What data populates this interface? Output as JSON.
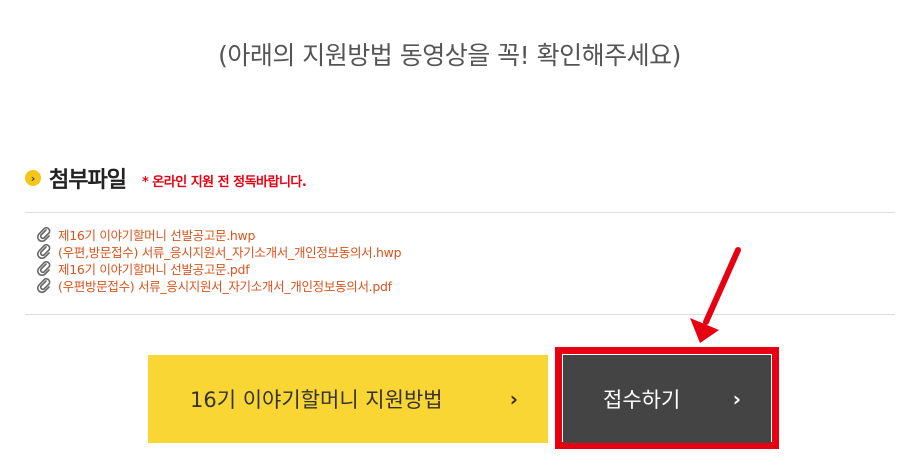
{
  "notice": "(아래의 지원방법 동영상을 꼭! 확인해주세요)",
  "attachments": {
    "title": "첨부파일",
    "warning": "* 온라인 지원 전 정독바랍니다.",
    "files": [
      "제16기 이야기할머니 선발공고문.hwp",
      "(우편,방문접수) 서류_응시지원서_자기소개서_개인정보동의서.hwp",
      "제16기 이야기할머니 선발공고문.pdf",
      "(우편방문접수) 서류_응시지원서_자기소개서_개인정보동의서.pdf"
    ]
  },
  "buttons": {
    "guide_label": "16기 이야기할머니 지원방법",
    "apply_label": "접수하기",
    "arrow": "›"
  },
  "colors": {
    "accent_yellow": "#fad634",
    "dark_button": "#444444",
    "highlight_red": "#e60012",
    "file_link": "#d9541e"
  },
  "icons": {
    "bullet": "chevron-right-icon",
    "file": "paperclip-icon",
    "annotation": "red-arrow-icon"
  }
}
